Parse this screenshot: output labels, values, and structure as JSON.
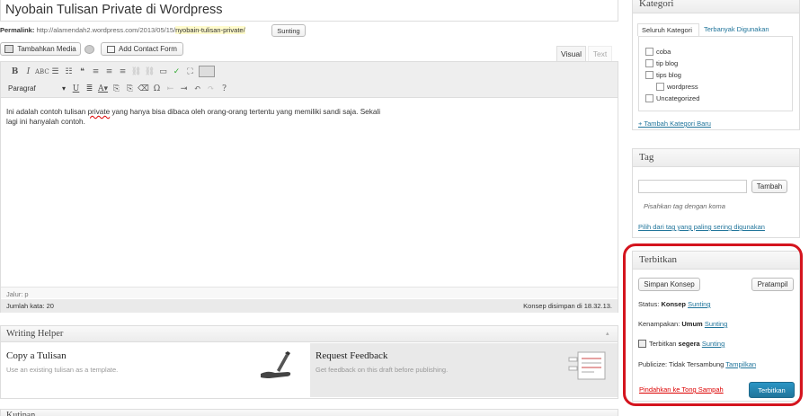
{
  "post": {
    "title": "Nyobain Tulisan Private di Wordpress",
    "permalink_label": "Permalink:",
    "permalink_base": "http://alamendah2.wordpress.com/2013/05/15/",
    "permalink_slug": "nyobain-tulisan-private/",
    "edit_slug_label": "Sunting"
  },
  "media": {
    "add_media_label": "Tambahkan Media",
    "add_contact_form_label": "Add Contact Form"
  },
  "editor": {
    "tab_visual": "Visual",
    "tab_text": "Text",
    "format_select": "Paragraf",
    "content_before": "Ini adalah contoh tulisan ",
    "content_misspelled": "private",
    "content_after": " yang hanya bisa dibaca oleh orang-orang tertentu yang memiliki sandi saja. Sekali lagi ini hanyalah contoh.",
    "path": "Jalur: p",
    "word_count": "Jumlah kata: 20",
    "draft_saved": "Konsep disimpan di 18.32.13."
  },
  "writing_helper": {
    "title": "Writing Helper",
    "copy_title": "Copy a Tulisan",
    "copy_desc": "Use an existing tulisan as a template.",
    "feedback_title": "Request Feedback",
    "feedback_desc": "Get feedback on this draft before publishing."
  },
  "next_box_title": "Kutipan",
  "categories": {
    "title": "Kategori",
    "tab_all": "Seluruh Kategori",
    "tab_popular": "Terbanyak Digunakan",
    "items": [
      "coba",
      "tip blog",
      "tips blog",
      "wordpress",
      "Uncategorized"
    ],
    "add_new": "+ Tambah Kategori Baru"
  },
  "tags": {
    "title": "Tag",
    "add_button": "Tambah",
    "hint": "Pisahkan tag dengan koma",
    "choose_popular": "Pilih dari tag yang paling sering digunakan"
  },
  "publish": {
    "title": "Terbitkan",
    "save_draft": "Simpan Konsep",
    "preview": "Pratampil",
    "status_label": "Status:",
    "status_value": "Konsep",
    "visibility_label": "Kenampakan:",
    "visibility_value": "Umum",
    "publish_label": "Terbitkan",
    "publish_value": "segera",
    "edit_link": "Sunting",
    "publicize_label": "Publicize: Tidak Tersambung",
    "publicize_link": "Tampilkan",
    "trash": "Pindahkan ke Tong Sampah",
    "publish_button": "Terbitkan"
  },
  "colors": {
    "accent": "#21759b",
    "highlight_ring": "#d4141e",
    "publish_button": "#21759b"
  }
}
